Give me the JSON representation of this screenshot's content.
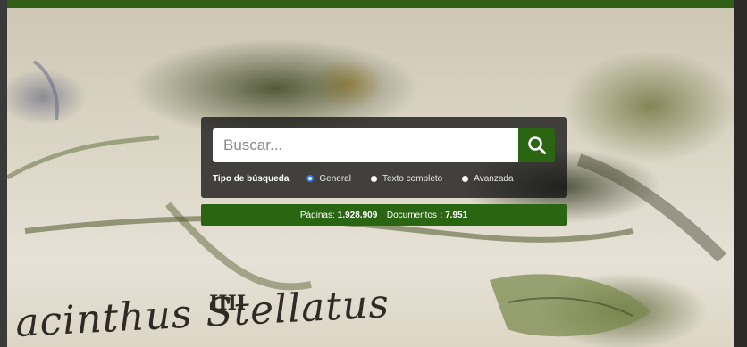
{
  "search": {
    "placeholder": "Buscar...",
    "type_label": "Tipo de búsqueda",
    "options": [
      {
        "label": "General",
        "selected": true
      },
      {
        "label": "Texto completo",
        "selected": false
      },
      {
        "label": "Avanzada",
        "selected": false
      }
    ]
  },
  "stats": {
    "pages_label": "Páginas:",
    "pages_value": "1.928.909",
    "separator": "|",
    "documents_label": "Documentos",
    "documents_value": ": 7.951"
  },
  "background": {
    "plate_numeral": "IIII",
    "plate_caption": "acinthus Stellatus"
  },
  "colors": {
    "brand_green": "#2a6512",
    "top_bar": "#2f5f14",
    "panel_overlay": "rgba(20,20,20,0.78)"
  },
  "icons": {
    "search_button": "search-icon"
  }
}
